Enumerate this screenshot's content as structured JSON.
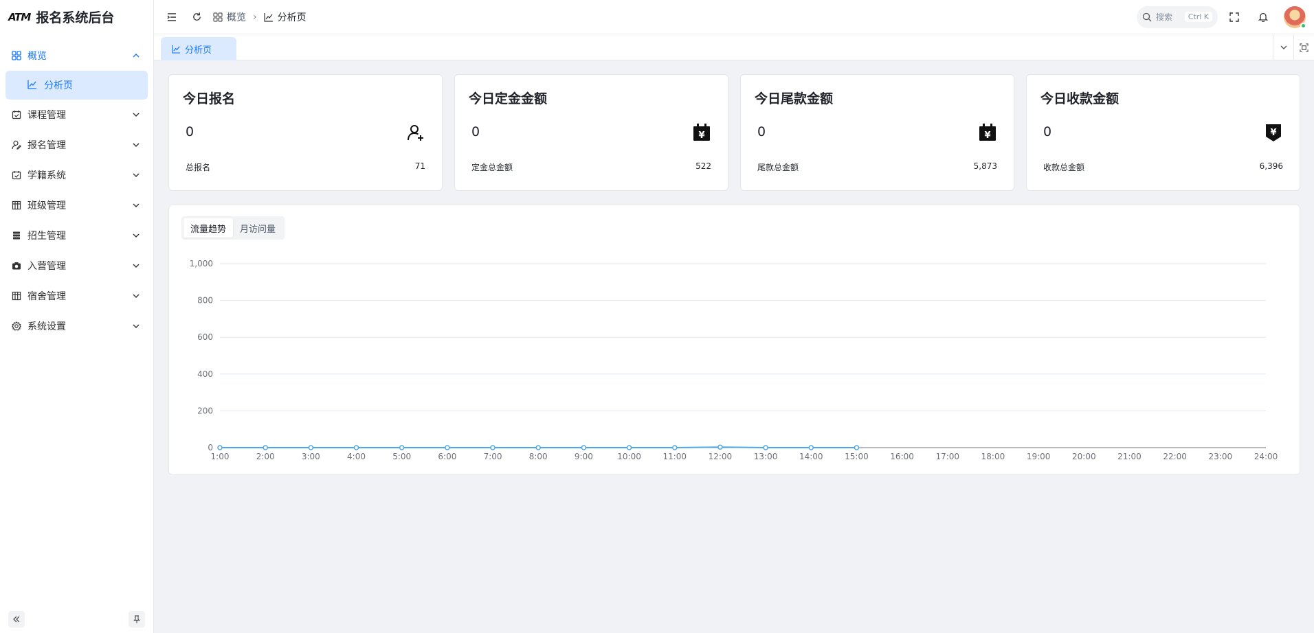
{
  "app": {
    "logo_text": "ATM",
    "title": "报名系统后台"
  },
  "sidebar": {
    "items": [
      {
        "label": "概览",
        "icon": "grid-icon",
        "open": true
      },
      {
        "label": "课程管理",
        "icon": "calendar-check-icon"
      },
      {
        "label": "报名管理",
        "icon": "user-edit-icon"
      },
      {
        "label": "学籍系统",
        "icon": "calendar-check-icon"
      },
      {
        "label": "班级管理",
        "icon": "table-icon"
      },
      {
        "label": "招生管理",
        "icon": "server-icon"
      },
      {
        "label": "入营管理",
        "icon": "camera-icon"
      },
      {
        "label": "宿舍管理",
        "icon": "table-icon"
      },
      {
        "label": "系统设置",
        "icon": "gear-icon"
      }
    ],
    "subitem": {
      "label": "分析页",
      "icon": "line-chart-icon"
    }
  },
  "header": {
    "breadcrumb": [
      "概览",
      "分析页"
    ],
    "search_placeholder": "搜索",
    "search_shortcut": "Ctrl K"
  },
  "tabs": {
    "active": "分析页"
  },
  "stats": [
    {
      "title": "今日报名",
      "value": "0",
      "foot_label": "总报名",
      "foot_value": "71",
      "icon": "user-add-icon"
    },
    {
      "title": "今日定金金额",
      "value": "0",
      "foot_label": "定金总金额",
      "foot_value": "522",
      "icon": "yen-calendar-icon"
    },
    {
      "title": "今日尾款金额",
      "value": "0",
      "foot_label": "尾款总金额",
      "foot_value": "5,873",
      "icon": "yen-calendar-icon"
    },
    {
      "title": "今日收款金额",
      "value": "0",
      "foot_label": "收款总金额",
      "foot_value": "6,396",
      "icon": "yen-download-icon"
    }
  ],
  "chart_tabs": [
    "流量趋势",
    "月访问量"
  ],
  "colors": {
    "accent": "#1677ff",
    "series": "#4ea7e6",
    "active_bg": "#dbeafe"
  },
  "chart_data": {
    "type": "line",
    "x": [
      "1:00",
      "2:00",
      "3:00",
      "4:00",
      "5:00",
      "6:00",
      "7:00",
      "8:00",
      "9:00",
      "10:00",
      "11:00",
      "12:00",
      "13:00",
      "14:00",
      "15:00",
      "16:00",
      "17:00",
      "18:00",
      "19:00",
      "20:00",
      "21:00",
      "22:00",
      "23:00",
      "24:00"
    ],
    "series": [
      {
        "values": [
          0,
          0,
          0,
          0,
          0,
          0,
          0,
          0,
          0,
          0,
          0,
          3,
          0,
          0,
          0
        ]
      }
    ],
    "yticks": [
      0,
      200,
      400,
      600,
      800,
      1000
    ],
    "ytick_labels": [
      "0",
      "200",
      "400",
      "600",
      "800",
      "1,000"
    ],
    "ylim": [
      0,
      1000
    ],
    "grid": true
  }
}
